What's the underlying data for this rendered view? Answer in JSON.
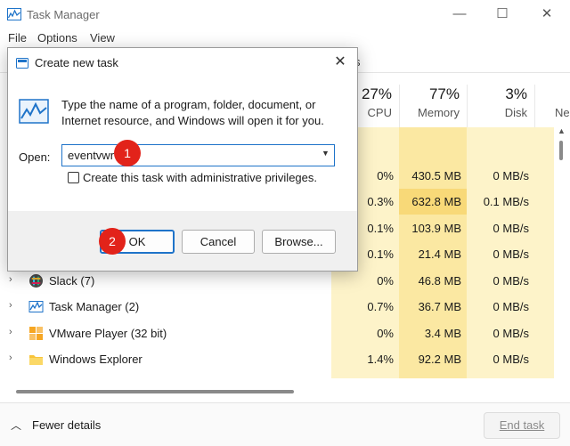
{
  "window": {
    "title": "Task Manager",
    "controls": {
      "minimize": "—",
      "maximize": "☐",
      "close": "✕"
    }
  },
  "menu": [
    "File",
    "Options",
    "View"
  ],
  "tabs": {
    "partial_visible": "s"
  },
  "columns": {
    "cpu": {
      "percent": "27%",
      "label": "CPU"
    },
    "memory": {
      "percent": "77%",
      "label": "Memory"
    },
    "disk": {
      "percent": "3%",
      "label": "Disk"
    },
    "network": {
      "label": "Ne"
    }
  },
  "processes": [
    {
      "name": "",
      "cpu": "0%",
      "memory": "430.5 MB",
      "disk": "0 MB/s"
    },
    {
      "name": "",
      "cpu": "0.3%",
      "memory": "632.8 MB",
      "disk": "0.1 MB/s"
    },
    {
      "name": "",
      "cpu": "0.1%",
      "memory": "103.9 MB",
      "disk": "0 MB/s"
    },
    {
      "name": "",
      "cpu": "0.1%",
      "memory": "21.4 MB",
      "disk": "0 MB/s"
    },
    {
      "name": "Slack (7)",
      "cpu": "0%",
      "memory": "46.8 MB",
      "disk": "0 MB/s",
      "icon": "slack-icon"
    },
    {
      "name": "Task Manager (2)",
      "cpu": "0.7%",
      "memory": "36.7 MB",
      "disk": "0 MB/s",
      "icon": "task-manager-icon"
    },
    {
      "name": "VMware Player (32 bit)",
      "cpu": "0%",
      "memory": "3.4 MB",
      "disk": "0 MB/s",
      "icon": "vmware-icon"
    },
    {
      "name": "Windows Explorer",
      "cpu": "1.4%",
      "memory": "92.2 MB",
      "disk": "0 MB/s",
      "icon": "folder-icon"
    }
  ],
  "footer": {
    "fewer_details": "Fewer details",
    "end_task": "End task"
  },
  "dialog": {
    "title": "Create new task",
    "description": "Type the name of a program, folder, document, or Internet resource, and Windows will open it for you.",
    "open_label": "Open:",
    "open_value": "eventvwr",
    "admin_label": "Create this task with administrative privileges.",
    "ok": "OK",
    "cancel": "Cancel",
    "browse": "Browse...",
    "close": "✕"
  },
  "annotations": {
    "step1": "1",
    "step2": "2"
  },
  "colors": {
    "accent": "#1e73c9",
    "badge": "#e2231a",
    "heat_light": "#fdf3c9",
    "heat_mid": "#fbe8a2"
  }
}
